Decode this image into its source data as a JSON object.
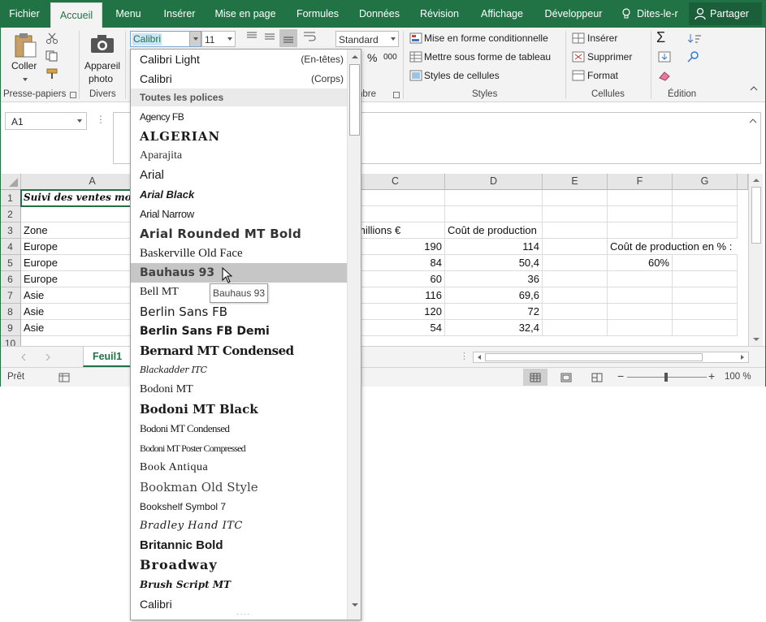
{
  "tabs": {
    "file": "Fichier",
    "home": "Accueil",
    "menu": "Menu",
    "insert": "Insérer",
    "layout": "Mise en page",
    "formulas": "Formules",
    "data": "Données",
    "review": "Révision",
    "view": "Affichage",
    "developer": "Développeur",
    "tell": "Dites-le-r",
    "share": "Partager"
  },
  "ribbon": {
    "paste_label": "Coller",
    "clipboard_group": "Presse-papiers",
    "camera_label_1": "Appareil",
    "camera_label_2": "photo",
    "misc_group": "Divers",
    "font_name": "Calibri",
    "font_size": "11",
    "number_format": "Standard",
    "percent": "%",
    "thousands": "000",
    "number_group_partial": "nbre",
    "cond_format": "Mise en forme conditionnelle",
    "table_format": "Mettre sous forme de tableau",
    "cell_styles": "Styles de cellules",
    "styles_group": "Styles",
    "insert_cells": "Insérer",
    "delete_cells": "Supprimer",
    "format_cells": "Format",
    "cells_group": "Cellules",
    "edit_group": "Édition"
  },
  "formula_bar": {
    "name_box": "A1"
  },
  "grid": {
    "columns": [
      "A",
      "C",
      "D",
      "E",
      "F",
      "G"
    ],
    "rows": [
      "1",
      "2",
      "3",
      "4",
      "5",
      "6",
      "7",
      "8",
      "9",
      "10"
    ],
    "a1": "Suivi des ventes mon",
    "a3": "Zone",
    "c3": "millions €",
    "d3": "Coût de production",
    "a4": "Europe",
    "c4": "190",
    "d4": "114",
    "f4": "Coût de production en % :",
    "a5": "Europe",
    "c5": "84",
    "d5": "50,4",
    "f5": "60%",
    "a6": "Europe",
    "c6": "60",
    "d6": "36",
    "a7": "Asie",
    "c7": "116",
    "d7": "69,6",
    "a8": "Asie",
    "c8": "120",
    "d8": "72",
    "a9": "Asie",
    "c9": "54",
    "d9": "32,4"
  },
  "sheet_tab": "Feuil1",
  "status": {
    "ready": "Prêt",
    "zoom": "100 %"
  },
  "font_dropdown": {
    "theme_fonts": [
      {
        "name": "Calibri Light",
        "tag": "(En-têtes)"
      },
      {
        "name": "Calibri",
        "tag": "(Corps)"
      }
    ],
    "section_title": "Toutes les polices",
    "fonts": [
      "Agency FB",
      "ALGERIAN",
      "Aparajita",
      "Arial",
      "Arial Black",
      "Arial Narrow",
      "Arial Rounded MT Bold",
      "Baskerville Old Face",
      "Bauhaus 93",
      "Bell MT",
      "Berlin Sans FB",
      "Berlin Sans FB Demi",
      "Bernard MT Condensed",
      "Blackadder ITC",
      "Bodoni MT",
      "Bodoni MT Black",
      "Bodoni MT Condensed",
      "Bodoni MT Poster Compressed",
      "Book Antiqua",
      "Bookman Old Style",
      "Bookshelf Symbol 7",
      "Bradley Hand ITC",
      "Britannic Bold",
      "Broadway",
      "Brush Script MT",
      "Calibri"
    ],
    "highlighted": "Bauhaus 93",
    "tooltip": "Bauhaus 93"
  }
}
